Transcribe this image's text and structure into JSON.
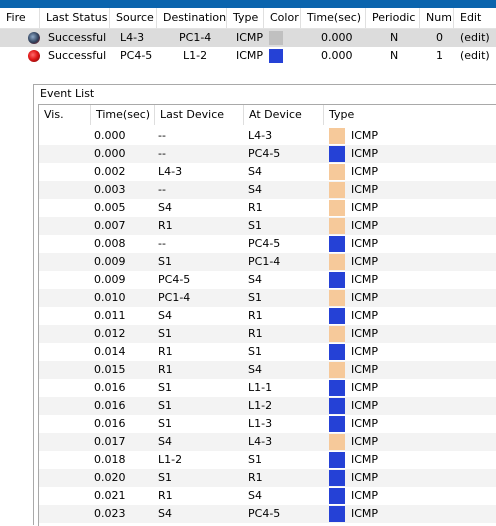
{
  "colors": {
    "light": "#f6c99a",
    "blue": "#2541d6",
    "selected_swatch": "#c0c0c0",
    "fire_red": "#e01818"
  },
  "pdu": {
    "headers": [
      "Fire",
      "Last Status",
      "Source",
      "Destination",
      "Type",
      "Color",
      "Time(sec)",
      "Periodic",
      "Num",
      "Edit"
    ],
    "rows": [
      {
        "status": "Successful",
        "source": "L4-3",
        "destination": "PC1-4",
        "type": "ICMP",
        "color": "gray",
        "time": "0.000",
        "periodic": "N",
        "num": "0",
        "edit": "(edit)"
      },
      {
        "status": "Successful",
        "source": "PC4-5",
        "destination": "L1-2",
        "type": "ICMP",
        "color": "blue",
        "time": "0.000",
        "periodic": "N",
        "num": "1",
        "edit": "(edit)"
      }
    ]
  },
  "event_list": {
    "title": "Event List",
    "headers": [
      "Vis.",
      "Time(sec)",
      "Last Device",
      "At Device",
      "Type"
    ],
    "rows": [
      {
        "time": "0.000",
        "last": "--",
        "at": "L4-3",
        "color": "light",
        "type": "ICMP"
      },
      {
        "time": "0.000",
        "last": "--",
        "at": "PC4-5",
        "color": "blue",
        "type": "ICMP"
      },
      {
        "time": "0.002",
        "last": "L4-3",
        "at": "S4",
        "color": "light",
        "type": "ICMP"
      },
      {
        "time": "0.003",
        "last": "--",
        "at": "S4",
        "color": "light",
        "type": "ICMP"
      },
      {
        "time": "0.005",
        "last": "S4",
        "at": "R1",
        "color": "light",
        "type": "ICMP"
      },
      {
        "time": "0.007",
        "last": "R1",
        "at": "S1",
        "color": "light",
        "type": "ICMP"
      },
      {
        "time": "0.008",
        "last": "--",
        "at": "PC4-5",
        "color": "blue",
        "type": "ICMP"
      },
      {
        "time": "0.009",
        "last": "S1",
        "at": "PC1-4",
        "color": "light",
        "type": "ICMP"
      },
      {
        "time": "0.009",
        "last": "PC4-5",
        "at": "S4",
        "color": "blue",
        "type": "ICMP"
      },
      {
        "time": "0.010",
        "last": "PC1-4",
        "at": "S1",
        "color": "light",
        "type": "ICMP"
      },
      {
        "time": "0.011",
        "last": "S4",
        "at": "R1",
        "color": "blue",
        "type": "ICMP"
      },
      {
        "time": "0.012",
        "last": "S1",
        "at": "R1",
        "color": "light",
        "type": "ICMP"
      },
      {
        "time": "0.014",
        "last": "R1",
        "at": "S1",
        "color": "blue",
        "type": "ICMP"
      },
      {
        "time": "0.015",
        "last": "R1",
        "at": "S4",
        "color": "light",
        "type": "ICMP"
      },
      {
        "time": "0.016",
        "last": "S1",
        "at": "L1-1",
        "color": "blue",
        "type": "ICMP"
      },
      {
        "time": "0.016",
        "last": "S1",
        "at": "L1-2",
        "color": "blue",
        "type": "ICMP"
      },
      {
        "time": "0.016",
        "last": "S1",
        "at": "L1-3",
        "color": "blue",
        "type": "ICMP"
      },
      {
        "time": "0.017",
        "last": "S4",
        "at": "L4-3",
        "color": "light",
        "type": "ICMP"
      },
      {
        "time": "0.018",
        "last": "L1-2",
        "at": "S1",
        "color": "blue",
        "type": "ICMP"
      },
      {
        "time": "0.020",
        "last": "S1",
        "at": "R1",
        "color": "blue",
        "type": "ICMP"
      },
      {
        "time": "0.021",
        "last": "R1",
        "at": "S4",
        "color": "blue",
        "type": "ICMP"
      },
      {
        "time": "0.023",
        "last": "S4",
        "at": "PC4-5",
        "color": "blue",
        "type": "ICMP"
      }
    ]
  }
}
